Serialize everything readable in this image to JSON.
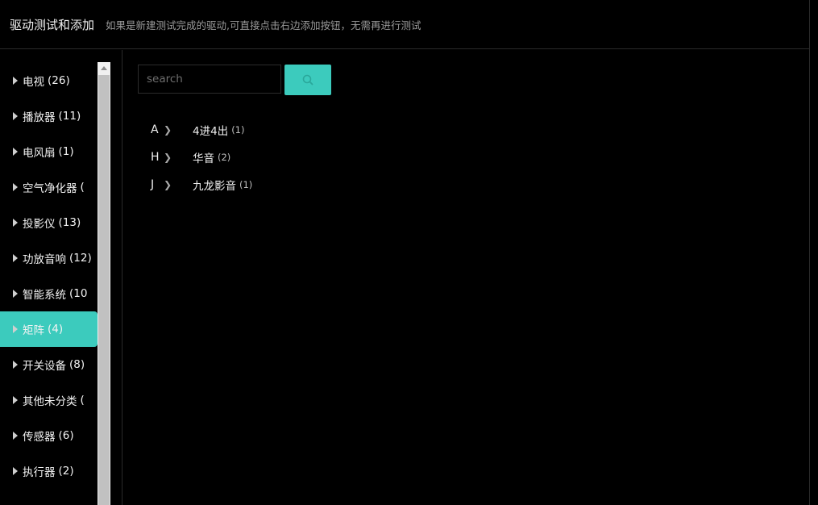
{
  "header": {
    "title": "驱动测试和添加",
    "subtitle": "如果是新建测试完成的驱动,可直接点击右边添加按钮，无需再进行测试"
  },
  "sidebar": {
    "items": [
      {
        "label": "电视",
        "count": "(26)"
      },
      {
        "label": "播放器",
        "count": "(11)"
      },
      {
        "label": "电风扇",
        "count": "(1)"
      },
      {
        "label": "空气净化器",
        "count": "("
      },
      {
        "label": "投影仪",
        "count": "(13)"
      },
      {
        "label": "功放音响",
        "count": "(12)"
      },
      {
        "label": "智能系统",
        "count": "(10"
      },
      {
        "label": "矩阵",
        "count": "(4)"
      },
      {
        "label": "开关设备",
        "count": "(8)"
      },
      {
        "label": "其他未分类",
        "count": "("
      },
      {
        "label": "传感器",
        "count": "(6)"
      },
      {
        "label": "执行器",
        "count": "(2)"
      }
    ],
    "active_index": 7
  },
  "search": {
    "placeholder": "search",
    "value": "",
    "button_icon": "search-icon"
  },
  "brands": [
    {
      "letter": "A",
      "name": "4进4出",
      "count": "(1)"
    },
    {
      "letter": "H",
      "name": "华音",
      "count": "(2)"
    },
    {
      "letter": "J",
      "name": "九龙影音",
      "count": "(1)"
    }
  ],
  "colors": {
    "accent": "#3ccbbd",
    "background": "#000000",
    "border": "#2a2a2a"
  }
}
